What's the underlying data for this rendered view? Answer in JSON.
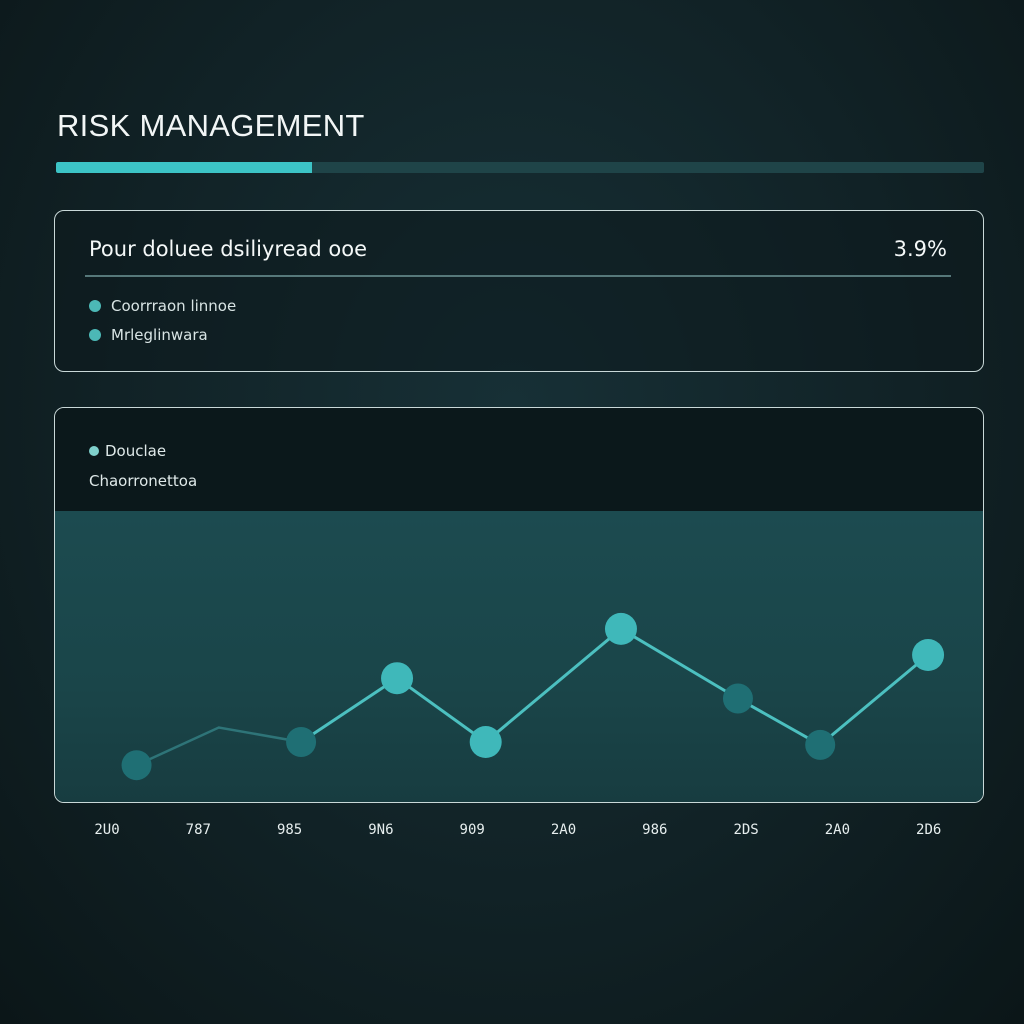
{
  "header": {
    "title": "RISK MANAGEMENT",
    "progress": 0.276
  },
  "summary": {
    "heading": "Pour doluee dsiliyread ooe",
    "value": "3.9%",
    "items": [
      {
        "label": "Coorrraon linnoe"
      },
      {
        "label": "Mrleglinwara"
      }
    ]
  },
  "chart_panel": {
    "legend_label": "Douclae",
    "subtitle": "Chaorronettoa"
  },
  "colors": {
    "accent": "#3cc4c6",
    "line": "#4cc0c0",
    "marker_bright": "#3fb8ba",
    "marker_dark": "#1f6f74"
  },
  "chart_data": {
    "type": "line",
    "categories": [
      "2U0",
      "787",
      "985",
      "9N6",
      "909",
      "2A0",
      "986",
      "2DS",
      "2A0",
      "2D6"
    ],
    "marker_x": [
      0.3,
      2.1,
      3.15,
      4.12,
      5.6,
      6.88,
      7.78,
      8.96
    ],
    "marker_values": [
      1.2,
      2.0,
      4.2,
      2.0,
      5.9,
      3.5,
      1.9,
      5.0
    ],
    "faint_segment": [
      [
        0.3,
        1.2
      ],
      [
        1.2,
        2.5
      ],
      [
        2.1,
        2.0
      ]
    ],
    "series": [
      {
        "values": [
          1.2,
          2.0,
          4.2,
          2.0,
          5.9,
          3.5,
          1.9,
          5.0
        ]
      }
    ],
    "marker_emphasis": [
      false,
      false,
      true,
      true,
      true,
      false,
      false,
      true
    ],
    "ylim": [
      0,
      10
    ],
    "xlim": [
      -0.1,
      9.2
    ],
    "grid": false,
    "legend": "top-left"
  }
}
